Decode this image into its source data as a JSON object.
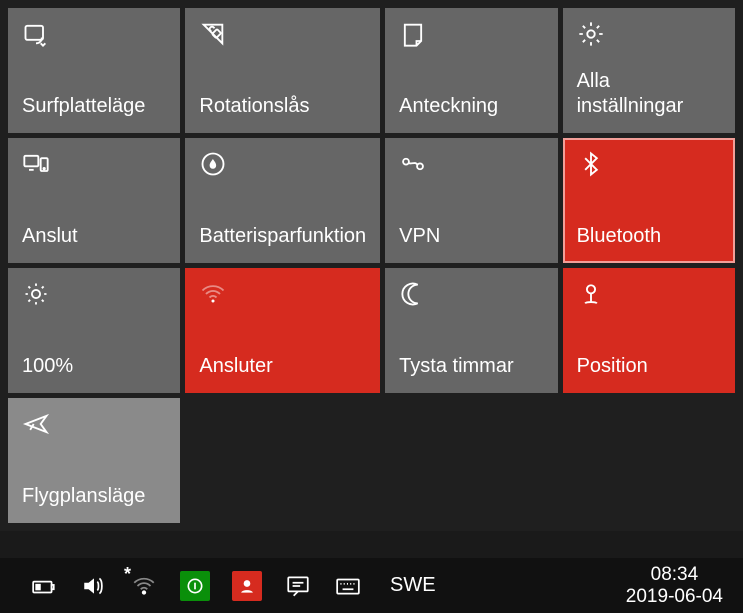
{
  "tiles": [
    {
      "label": "Surfplatteläge",
      "icon": "tablet-mode-icon",
      "style": "grey"
    },
    {
      "label": "Rotationslås",
      "icon": "rotation-lock-icon",
      "style": "grey"
    },
    {
      "label": "Anteckning",
      "icon": "note-icon",
      "style": "grey"
    },
    {
      "label": "Alla inställningar",
      "icon": "settings-gear-icon",
      "style": "grey"
    },
    {
      "label": "Anslut",
      "icon": "connect-devices-icon",
      "style": "grey"
    },
    {
      "label": "Batterisparfunktion",
      "icon": "battery-saver-icon",
      "style": "grey"
    },
    {
      "label": "VPN",
      "icon": "vpn-icon",
      "style": "grey"
    },
    {
      "label": "Bluetooth",
      "icon": "bluetooth-icon",
      "style": "red-bordered"
    },
    {
      "label": "100%",
      "icon": "brightness-icon",
      "style": "grey"
    },
    {
      "label": "Ansluter",
      "icon": "wifi-icon",
      "style": "red"
    },
    {
      "label": "Tysta timmar",
      "icon": "quiet-hours-moon-icon",
      "style": "grey"
    },
    {
      "label": "Position",
      "icon": "location-pin-icon",
      "style": "red"
    },
    {
      "label": "Flygplansläge",
      "icon": "airplane-mode-icon",
      "style": "lightgrey"
    }
  ],
  "taskbar": {
    "language": "SWE",
    "time": "08:34",
    "date": "2019-06-04"
  }
}
